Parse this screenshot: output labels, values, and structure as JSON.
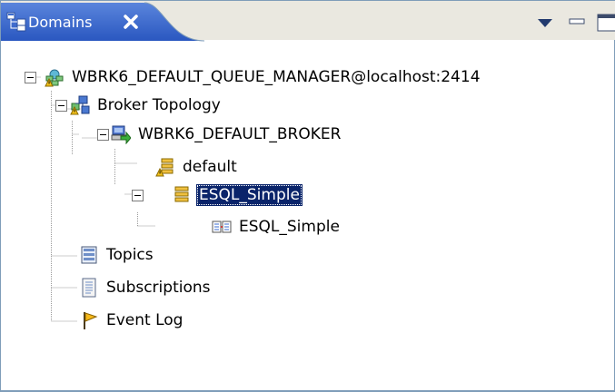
{
  "view": {
    "tab_title": "Domains",
    "tab_icon": "domains-icon",
    "close_icon": "close-icon",
    "toolbar_icons": [
      "view-menu-icon",
      "minimize-icon",
      "maximize-icon"
    ]
  },
  "tree": {
    "queue_manager": {
      "label": "WBRK6_DEFAULT_QUEUE_MANAGER@localhost:2414",
      "icon": "queue-manager-warning-icon",
      "expanded": true
    },
    "broker_topology": {
      "label": "Broker Topology",
      "icon": "broker-topology-warning-icon",
      "expanded": true
    },
    "broker": {
      "label": "WBRK6_DEFAULT_BROKER",
      "icon": "broker-icon",
      "expanded": true
    },
    "eg_default": {
      "label": "default",
      "icon": "execution-group-warning-icon"
    },
    "eg_esql": {
      "label": "ESQL_Simple",
      "icon": "execution-group-icon",
      "expanded": true,
      "selected": true
    },
    "flow_esql": {
      "label": "ESQL_Simple",
      "icon": "message-flow-icon"
    },
    "topics": {
      "label": "Topics",
      "icon": "topics-icon"
    },
    "subscriptions": {
      "label": "Subscriptions",
      "icon": "subscriptions-icon"
    },
    "event_log": {
      "label": "Event Log",
      "icon": "event-log-flag-icon"
    }
  },
  "colors": {
    "tab_active": "#2f5ec4",
    "tab_strip": "#eae8e0",
    "selection": "#0a246a",
    "border": "#7f9db9"
  }
}
